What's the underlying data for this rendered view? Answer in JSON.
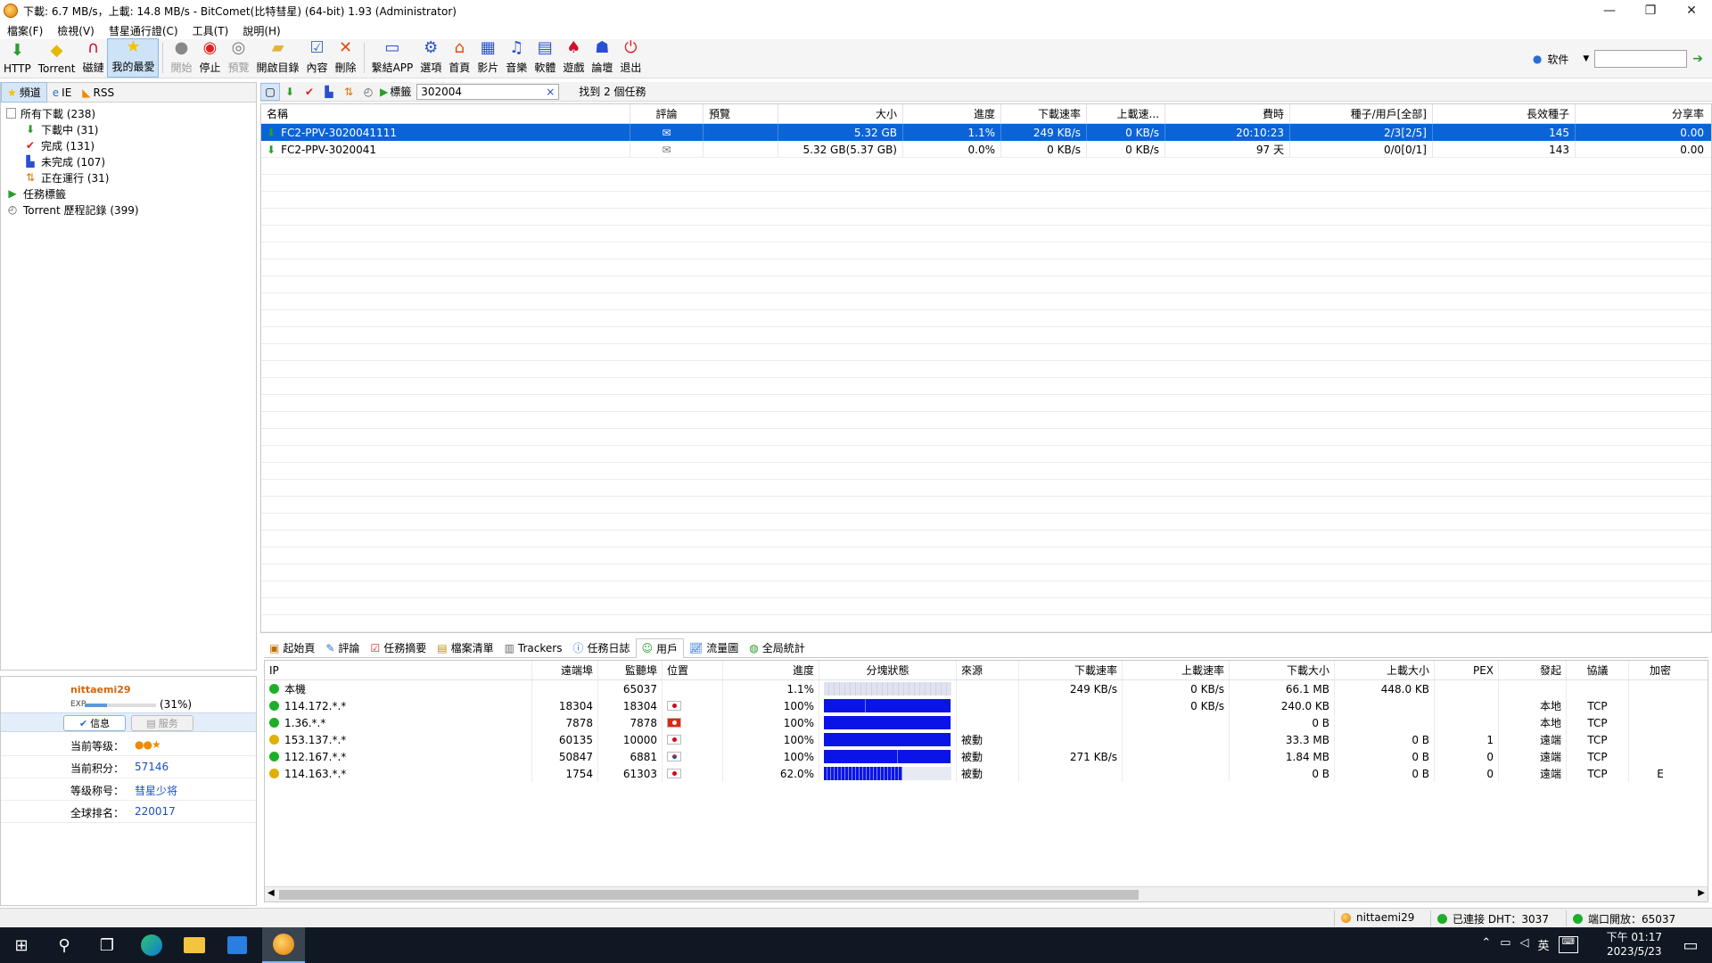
{
  "window": {
    "title": "下載: 6.7 MB/s，上載: 14.8 MB/s - BitComet(比特彗星) (64-bit) 1.93 (Administrator)",
    "controls": [
      "—",
      "❐",
      "✕"
    ]
  },
  "menu": [
    "檔案(F)",
    "檢視(V)",
    "彗星通行證(C)",
    "工具(T)",
    "說明(H)"
  ],
  "toolbar": {
    "buttons": [
      {
        "label": "HTTP",
        "icon": "http-download-icon"
      },
      {
        "label": "Torrent",
        "icon": "torrent-icon"
      },
      {
        "label": "磁鏈",
        "icon": "magnet-icon"
      },
      {
        "label": "我的最愛",
        "icon": "favorite-star-icon"
      },
      {
        "label": "開始",
        "icon": "start-icon"
      },
      {
        "label": "停止",
        "icon": "stop-icon"
      },
      {
        "label": "預覽",
        "icon": "preview-icon"
      },
      {
        "label": "開啟目錄",
        "icon": "open-folder-icon"
      },
      {
        "label": "內容",
        "icon": "properties-icon"
      },
      {
        "label": "刪除",
        "icon": "delete-icon"
      },
      {
        "label": "繫結APP",
        "icon": "bind-app-icon"
      },
      {
        "label": "選項",
        "icon": "options-icon"
      },
      {
        "label": "首頁",
        "icon": "home-icon"
      },
      {
        "label": "影片",
        "icon": "video-icon"
      },
      {
        "label": "音樂",
        "icon": "music-icon"
      },
      {
        "label": "軟體",
        "icon": "software-icon"
      },
      {
        "label": "遊戲",
        "icon": "game-icon"
      },
      {
        "label": "論壇",
        "icon": "forum-icon"
      },
      {
        "label": "退出",
        "icon": "exit-icon"
      }
    ],
    "search_engine_label": "软件"
  },
  "sidebar": {
    "tabs": [
      "頻道",
      "IE",
      "RSS"
    ],
    "tree": [
      {
        "label": "所有下載 (238)",
        "icon": "all-downloads-icon",
        "indent": 0
      },
      {
        "label": "下載中 (31)",
        "icon": "downloading-icon",
        "indent": 1
      },
      {
        "label": "完成 (131)",
        "icon": "completed-icon",
        "indent": 1
      },
      {
        "label": "未完成 (107)",
        "icon": "incomplete-icon",
        "indent": 1
      },
      {
        "label": "正在運行 (31)",
        "icon": "running-icon",
        "indent": 1
      },
      {
        "label": "任務標籤",
        "icon": "task-tags-icon",
        "indent": 0
      },
      {
        "label": "Torrent 歷程記錄 (399)",
        "icon": "torrent-history-icon",
        "indent": 0
      }
    ]
  },
  "user": {
    "name": "nittaemi29",
    "exp_label": "EXP",
    "exp_percent": "(31%)",
    "exp_fraction": 0.31,
    "info_button": "信息",
    "service_button": "服务",
    "rows": [
      {
        "key": "当前等级：",
        "value": "",
        "value_kind": "level-badges"
      },
      {
        "key": "当前积分：",
        "value": "57146"
      },
      {
        "key": "等级称号：",
        "value": "彗星少将"
      },
      {
        "key": "全球排名：",
        "value": "220017"
      }
    ]
  },
  "task_toolbar": {
    "tag_label": "標籤",
    "search_value": "302004",
    "clear_icon": "×",
    "result_text": "找到 2 個任務"
  },
  "tasks": {
    "columns": [
      "名稱",
      "評論",
      "預覽",
      "大小",
      "進度",
      "下載速率",
      "上載速...",
      "費時",
      "種子/用戶[全部]",
      "長效種子",
      "分享率"
    ],
    "rows": [
      {
        "name": "FC2-PPV-3020041111",
        "comment": "✉",
        "preview": "",
        "size": "5.32 GB",
        "progress": "1.1%",
        "down": "249 KB/s",
        "up": "0 KB/s",
        "time": "20:10:23",
        "seeds": "2/3[2/5]",
        "longseed": "145",
        "ratio": "0.00",
        "selected": true
      },
      {
        "name": "FC2-PPV-3020041",
        "comment": "✉",
        "preview": "",
        "size": "5.32 GB(5.37 GB)",
        "progress": "0.0%",
        "down": "0 KB/s",
        "up": "0 KB/s",
        "time": "97 天",
        "seeds": "0/0[0/1]",
        "longseed": "143",
        "ratio": "0.00",
        "selected": false
      }
    ]
  },
  "bottom_tabs": [
    {
      "label": "起始頁",
      "icon": "start-page-icon"
    },
    {
      "label": "評論",
      "icon": "comment-icon"
    },
    {
      "label": "任務摘要",
      "icon": "task-summary-icon"
    },
    {
      "label": "檔案清單",
      "icon": "file-list-icon"
    },
    {
      "label": "Trackers",
      "icon": "trackers-icon"
    },
    {
      "label": "任務日誌",
      "icon": "task-log-icon"
    },
    {
      "label": "用戶",
      "icon": "peers-icon",
      "active": true
    },
    {
      "label": "流量圖",
      "icon": "traffic-graph-icon"
    },
    {
      "label": "全局統計",
      "icon": "global-stats-icon"
    }
  ],
  "peers": {
    "columns": [
      "IP",
      "遠端埠",
      "監聽埠",
      "位置",
      "進度",
      "分塊狀態",
      "來源",
      "下載速率",
      "上載速率",
      "下載大小",
      "上載大小",
      "PEX",
      "發起",
      "協議",
      "加密"
    ],
    "rows": [
      {
        "ip": "本機",
        "status": "green",
        "rport": "",
        "lport": "65037",
        "flag": "",
        "progress": "1.1%",
        "fill": 0.0,
        "source": "",
        "down": "249 KB/s",
        "up": "0 KB/s",
        "dsize": "66.1 MB",
        "usize": "448.0 KB",
        "pex": "",
        "init": "",
        "proto": "",
        "enc": ""
      },
      {
        "ip": "114.172.*.*",
        "status": "green",
        "rport": "18304",
        "lport": "18304",
        "flag": "jp",
        "progress": "100%",
        "fill": 1.0,
        "source": "",
        "down": "",
        "up": "0 KB/s",
        "dsize": "240.0 KB",
        "usize": "",
        "pex": "",
        "init": "本地",
        "proto": "TCP",
        "enc": ""
      },
      {
        "ip": "1.36.*.*",
        "status": "green",
        "rport": "7878",
        "lport": "7878",
        "flag": "hk",
        "progress": "100%",
        "fill": 1.0,
        "source": "",
        "down": "",
        "up": "",
        "dsize": "0 B",
        "usize": "",
        "pex": "",
        "init": "本地",
        "proto": "TCP",
        "enc": ""
      },
      {
        "ip": "153.137.*.*",
        "status": "yellow",
        "rport": "60135",
        "lport": "10000",
        "flag": "jp",
        "progress": "100%",
        "fill": 1.0,
        "source": "被動",
        "down": "",
        "up": "",
        "dsize": "33.3 MB",
        "usize": "0 B",
        "pex": "1",
        "init": "遠端",
        "proto": "TCP",
        "enc": ""
      },
      {
        "ip": "112.167.*.*",
        "status": "green",
        "rport": "50847",
        "lport": "6881",
        "flag": "kr",
        "progress": "100%",
        "fill": 1.0,
        "source": "被動",
        "down": "271 KB/s",
        "up": "",
        "dsize": "1.84 MB",
        "usize": "0 B",
        "pex": "0",
        "init": "遠端",
        "proto": "TCP",
        "enc": ""
      },
      {
        "ip": "114.163.*.*",
        "status": "yellow",
        "rport": "1754",
        "lport": "61303",
        "flag": "jp",
        "progress": "62.0%",
        "fill": 0.62,
        "source": "被動",
        "down": "",
        "up": "",
        "dsize": "0 B",
        "usize": "0 B",
        "pex": "0",
        "init": "遠端",
        "proto": "TCP",
        "enc": "E"
      }
    ]
  },
  "statusbar": {
    "user": "nittaemi29",
    "dht": "已連接 DHT：3037",
    "port": "端口開放：65037"
  },
  "taskbar": {
    "items": [
      "windows-start-icon",
      "search-icon",
      "task-view-icon",
      "edge-icon",
      "file-explorer-icon",
      "store-icon",
      "bitcomet-icon"
    ],
    "tray_lang": "英",
    "time": "下午 01:17",
    "date": "2023/5/23"
  }
}
